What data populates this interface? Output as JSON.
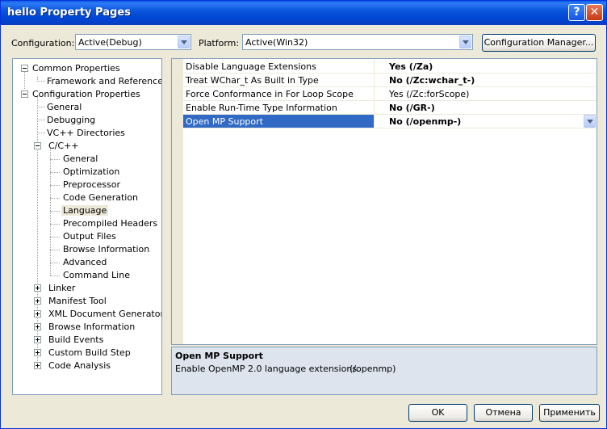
{
  "window": {
    "title": "hello Property Pages"
  },
  "toolbar": {
    "configuration_label": "Configuration:",
    "configuration_value": "Active(Debug)",
    "platform_label": "Platform:",
    "platform_value": "Active(Win32)",
    "config_manager_label": "Configuration Manager..."
  },
  "tree": {
    "common_properties": "Common Properties",
    "framework_refs": "Framework and References",
    "configuration_properties": "Configuration Properties",
    "general": "General",
    "debugging": "Debugging",
    "vc_directories": "VC++ Directories",
    "cpp": "C/C++",
    "cpp_items": [
      "General",
      "Optimization",
      "Preprocessor",
      "Code Generation",
      "Language",
      "Precompiled Headers",
      "Output Files",
      "Browse Information",
      "Advanced",
      "Command Line"
    ],
    "collapsed_items": [
      "Linker",
      "Manifest Tool",
      "XML Document Generator",
      "Browse Information",
      "Build Events",
      "Custom Build Step",
      "Code Analysis"
    ],
    "selected": "Language"
  },
  "properties": [
    {
      "name": "Disable Language Extensions",
      "value": "Yes (/Za)",
      "bold": true
    },
    {
      "name": "Treat WChar_t As Built in Type",
      "value": "No (/Zc:wchar_t-)",
      "bold": true
    },
    {
      "name": "Force Conformance in For Loop Scope",
      "value": "Yes (/Zc:forScope)",
      "bold": false
    },
    {
      "name": "Enable Run-Time Type Information",
      "value": "No (/GR-)",
      "bold": true
    },
    {
      "name": "Open MP Support",
      "value": "No (/openmp-)",
      "bold": true,
      "selected": true
    }
  ],
  "description": {
    "title": "Open MP Support",
    "text": "Enable OpenMP 2.0 language extensions.",
    "switch": "(/openmp)"
  },
  "buttons": {
    "ok": "OK",
    "cancel": "Отмена",
    "apply": "Применить"
  },
  "colors": {
    "titlebar": "#0a56dc",
    "selection": "#316ac5",
    "face": "#ece9d8"
  }
}
